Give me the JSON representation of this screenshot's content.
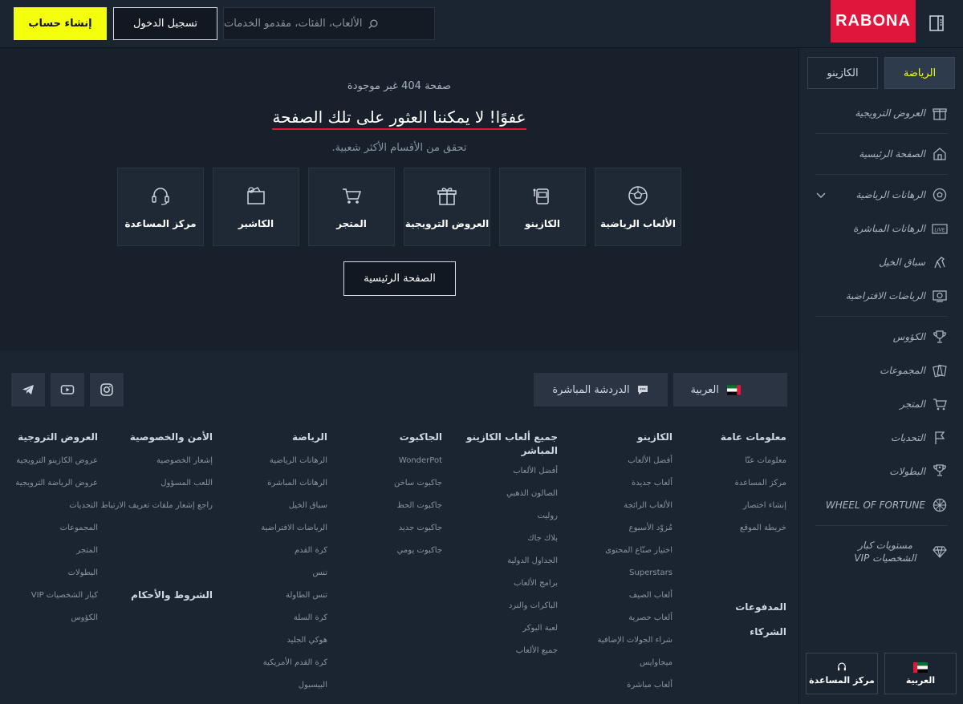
{
  "header": {
    "signup": "إنشاء حساب",
    "login": "تسجيل الدخول",
    "search_placeholder": "الألعاب، الفئات، مقدمو الخدمات",
    "logo": "RABONA"
  },
  "sidebar": {
    "tabs": [
      {
        "label": "الرياضة",
        "active": true
      },
      {
        "label": "الكازينو",
        "active": false
      }
    ],
    "items": [
      {
        "label": "العروض الترويجية",
        "icon": "gift-icon"
      },
      {
        "label": "الصفحة الرئيسية",
        "icon": "home-icon"
      },
      {
        "label": "الرهانات الرياضية",
        "icon": "soccer-ball-icon"
      },
      {
        "label": "الرهانات المباشرة",
        "icon": "live-icon"
      },
      {
        "label": "سباق الخيل",
        "icon": "horse-icon"
      },
      {
        "label": "الرياضات الافتراضية",
        "icon": "virtual-sports-icon"
      },
      {
        "label": "الكؤوس",
        "icon": "trophy-icon"
      },
      {
        "label": "المجموعات",
        "icon": "cards-icon"
      },
      {
        "label": "المتجر",
        "icon": "cart-icon"
      },
      {
        "label": "التحديات",
        "icon": "flag-icon"
      },
      {
        "label": "البطولات",
        "icon": "medal-icon"
      },
      {
        "label": "WHEEL OF FORTUNE",
        "icon": "wheel-icon"
      },
      {
        "label": "مستويات كبار الشخصيات VIP",
        "icon": "diamond-icon"
      }
    ],
    "live_badge": "LIVE",
    "bottom": {
      "language": "العربية",
      "help": "مركز المساعدة"
    }
  },
  "main": {
    "subtitle": "صفحة 404 غير موجودة",
    "title": "عفوًا! لا يمكننا العثور على تلك الصفحة",
    "hint": "تحقق من الأقسام الأكثر شعبية.",
    "cards": [
      {
        "label": "الألعاب الرياضية",
        "icon": "soccer-ball-icon"
      },
      {
        "label": "الكازينو",
        "icon": "slot-machine-icon"
      },
      {
        "label": "العروض الترويجية",
        "icon": "gift-icon"
      },
      {
        "label": "المتجر",
        "icon": "cart-icon"
      },
      {
        "label": "الكاشير",
        "icon": "wallet-icon"
      },
      {
        "label": "مركز المساعدة",
        "icon": "headset-icon"
      }
    ],
    "home_button": "الصفحة الرئيسية"
  },
  "footer": {
    "language": "العربية",
    "live_chat": "الدردشة المباشرة",
    "columns": [
      {
        "title": "معلومات عامة",
        "links": [
          "معلومات عنّا",
          "مركز المساعدة",
          "إنشاء اختصار",
          "خريطة الموقع"
        ],
        "extra": [
          "المدفوعات",
          "الشركاء"
        ]
      },
      {
        "title": "الكازينو",
        "links": [
          "أفضل الألعاب",
          "ألعاب جديدة",
          "الألعاب الرائجة",
          "مُزوّد الأسبوع",
          "اختيار صنّاع المحتوى",
          "Superstars",
          "ألعاب الصيف",
          "ألعاب حصرية",
          "شراء الجولات الإضافية",
          "ميجاوايس",
          "ألعاب مباشرة"
        ]
      },
      {
        "title": "جميع ألعاب الكازينو المباشر",
        "links": [
          "أفضل الألعاب",
          "الصالون الذهبي",
          "روليت",
          "بلاك جاك",
          "الجداول الدولية",
          "برامج الألعاب",
          "الباكرات والنرد",
          "لعبة البوكر",
          "جميع الألعاب"
        ]
      },
      {
        "title": "الجاكبوت",
        "links": [
          "WonderPot",
          "جاكبوت ساخن",
          "جاكبوت الحظ",
          "جاكبوت جديد",
          "جاكبوت يومي"
        ]
      },
      {
        "title": "الرياضة",
        "links": [
          "الرهانات الرياضية",
          "الرهانات المباشرة",
          "سباق الخيل",
          "الرياضات الافتراضية",
          "كرة القدم",
          "تنس",
          "تنس الطاولة",
          "كرة السلة",
          "هوكي الجليد",
          "كرة القدم الأمريكية",
          "البيسبول"
        ]
      },
      {
        "title": "الأمن والخصوصية",
        "links": [
          "إشعار الخصوصية",
          "اللعب المسؤول",
          "راجع إشعار ملفات تعريف الارتباط"
        ],
        "extra": [
          "الشروط والأحكام"
        ]
      },
      {
        "title": "العروض التروجية",
        "links": [
          "عروض الكازينو الترويجية",
          "عروض الرياضة الترويجية",
          "التحديات",
          "المجموعات",
          "المتجر",
          "البطولات",
          "كبار الشخصيات VIP",
          "الكؤوس"
        ]
      }
    ]
  },
  "colors": {
    "accent": "#f4ff0d",
    "brand": "#e1163c",
    "background": "#18202c"
  }
}
